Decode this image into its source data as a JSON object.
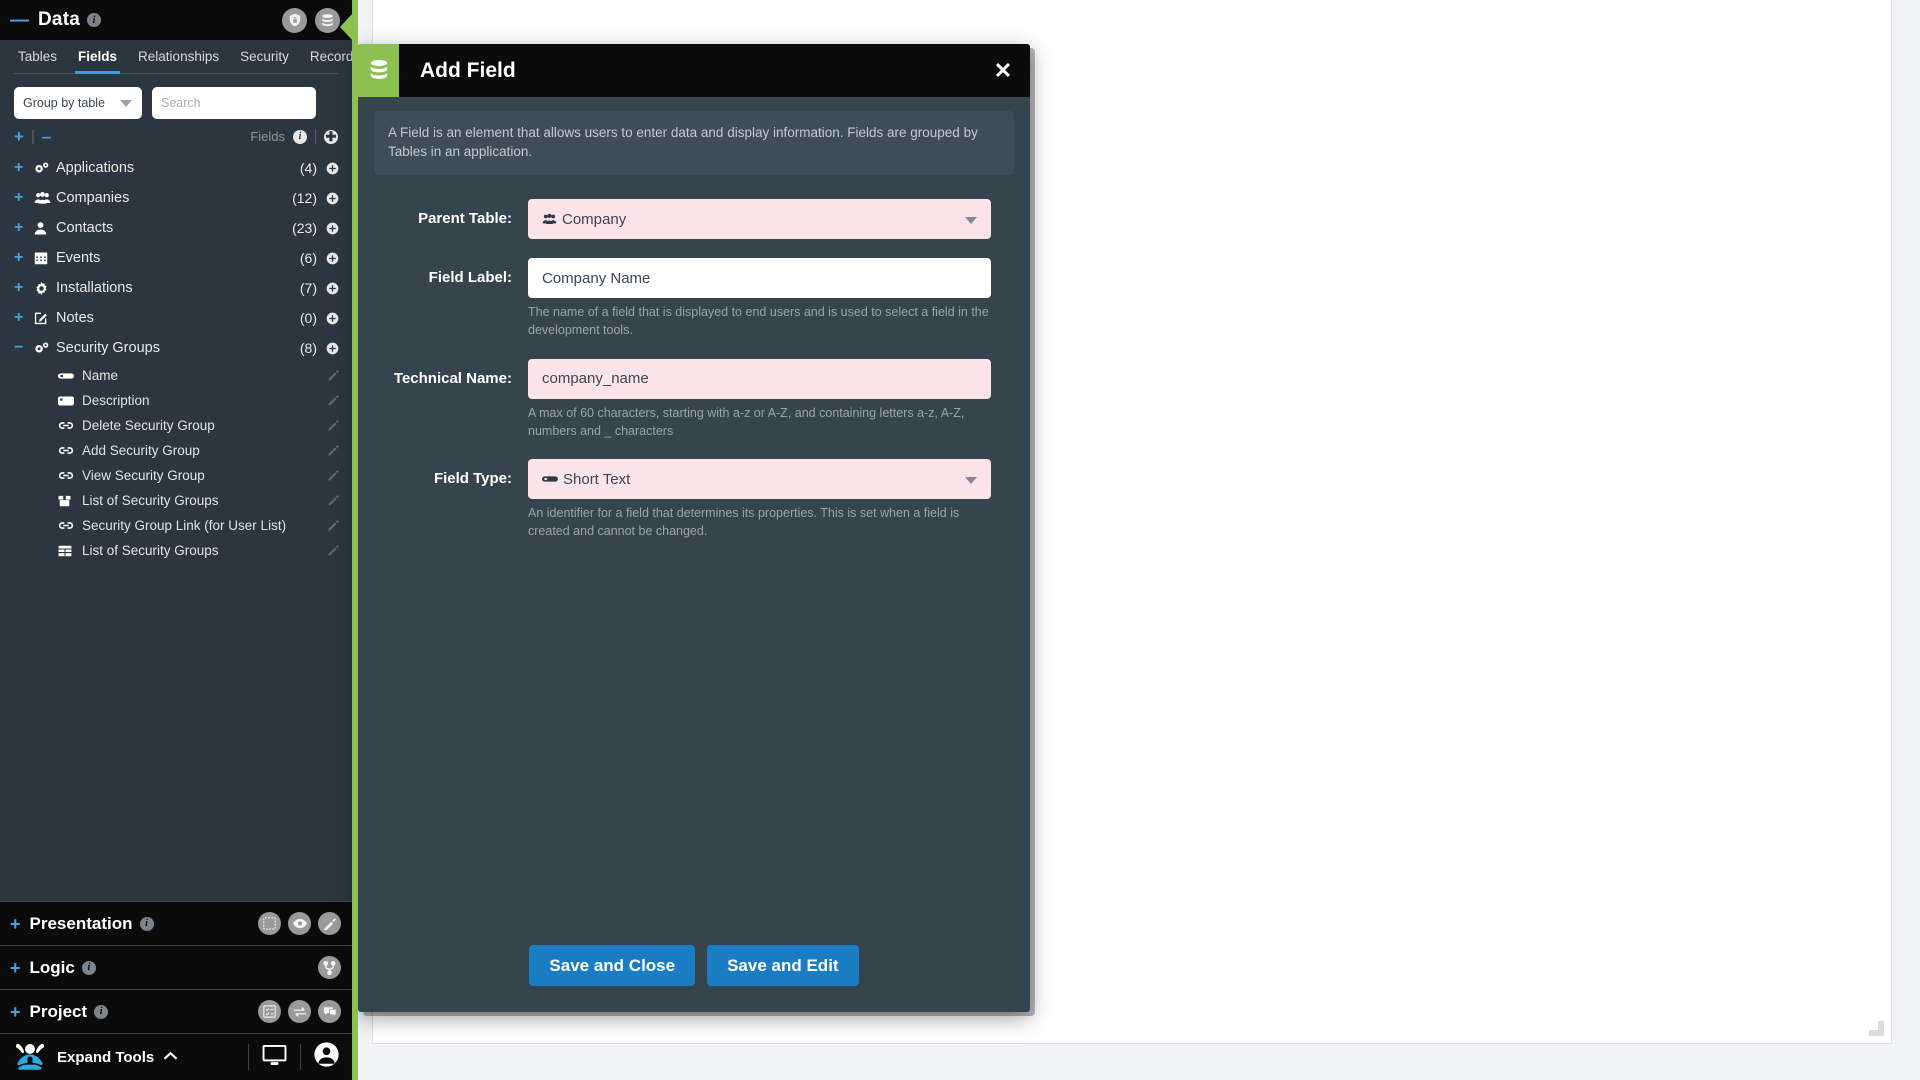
{
  "panel": {
    "header": {
      "title": "Data",
      "collapse_icon": "minus-icon",
      "info_icon": "info-icon",
      "actions": [
        {
          "name": "security-lock-button",
          "icon": "shield-lock-icon"
        },
        {
          "name": "database-button",
          "icon": "database-icon"
        }
      ]
    },
    "tabs": [
      {
        "label": "Tables",
        "active": false
      },
      {
        "label": "Fields",
        "active": true
      },
      {
        "label": "Relationships",
        "active": false
      },
      {
        "label": "Security",
        "active": false
      },
      {
        "label": "Records",
        "active": false
      }
    ],
    "group_select": {
      "value": "Group by table"
    },
    "search": {
      "placeholder": "Search",
      "value": ""
    },
    "tree_toolbar": {
      "expand_all": "+",
      "separator": "|",
      "collapse_all": "–",
      "label": "Fields",
      "info_icon": "info-icon",
      "add_icon": "plus-circle-icon"
    },
    "tree": [
      {
        "name": "Applications",
        "count": "(4)",
        "expanded": false,
        "icon": "gears-icon"
      },
      {
        "name": "Companies",
        "count": "(12)",
        "expanded": false,
        "icon": "users-icon"
      },
      {
        "name": "Contacts",
        "count": "(23)",
        "expanded": false,
        "icon": "user-icon"
      },
      {
        "name": "Events",
        "count": "(6)",
        "expanded": false,
        "icon": "calendar-icon"
      },
      {
        "name": "Installations",
        "count": "(7)",
        "expanded": false,
        "icon": "gear-icon"
      },
      {
        "name": "Notes",
        "count": "(0)",
        "expanded": false,
        "icon": "note-edit-icon"
      },
      {
        "name": "Security Groups",
        "count": "(8)",
        "expanded": true,
        "icon": "gears-icon",
        "children": [
          {
            "name": "Name",
            "icon": "text-field-icon"
          },
          {
            "name": "Description",
            "icon": "text-area-icon"
          },
          {
            "name": "Delete Security Group",
            "icon": "link-icon"
          },
          {
            "name": "Add Security Group",
            "icon": "link-icon"
          },
          {
            "name": "View Security Group",
            "icon": "link-icon"
          },
          {
            "name": "List of Security Groups",
            "icon": "box-icon"
          },
          {
            "name": "Security Group Link (for User List)",
            "icon": "link-icon"
          },
          {
            "name": "List of Security Groups",
            "icon": "grid-icon"
          }
        ]
      }
    ],
    "sections": [
      {
        "title": "Presentation",
        "icons": [
          "interface-icon",
          "eye-icon",
          "brush-icon"
        ]
      },
      {
        "title": "Logic",
        "icons": [
          "branch-icon"
        ]
      },
      {
        "title": "Project",
        "icons": [
          "tasks-icon",
          "exchange-icon",
          "comments-icon"
        ]
      }
    ],
    "footer": {
      "logo": "appian-logo-icon",
      "expand_label": "Expand Tools",
      "chevron": "chevron-up-icon",
      "monitor_icon": "monitor-icon",
      "user_icon": "user-avatar-icon"
    }
  },
  "modal": {
    "title": "Add Field",
    "badge_icon": "database-icon",
    "close_label": "✕",
    "description": "A Field is an element that allows users to enter data and display information. Fields are grouped by Tables in an application.",
    "fields": {
      "parent_table": {
        "label": "Parent Table:",
        "value": "Company",
        "icon": "users-icon",
        "invalid": true
      },
      "field_label": {
        "label": "Field Label:",
        "value": "Company Name",
        "invalid": false,
        "hint": "The name of a field that is displayed to end users and is used to select a field in the development tools."
      },
      "technical_name": {
        "label": "Technical Name:",
        "value": "company_name",
        "invalid": true,
        "hint": "A max of 60 characters, starting with a-z or A-Z, and containing letters a-z, A-Z, numbers and _ characters"
      },
      "field_type": {
        "label": "Field Type:",
        "value": "Short Text",
        "icon": "text-field-icon",
        "invalid": true,
        "hint": "An identifier for a field that determines its properties. This is set when a field is created and cannot be changed."
      }
    },
    "buttons": {
      "save_close": "Save and Close",
      "save_edit": "Save and Edit"
    }
  },
  "colors": {
    "accent_blue": "#3aa0dd",
    "accent_green": "#8cc051",
    "button_blue": "#1a7dc4",
    "panel_dark": "#2b3640",
    "header_black": "#0b0b0b",
    "modal_body": "#36444e",
    "invalid_pink": "#fbe4e9"
  }
}
